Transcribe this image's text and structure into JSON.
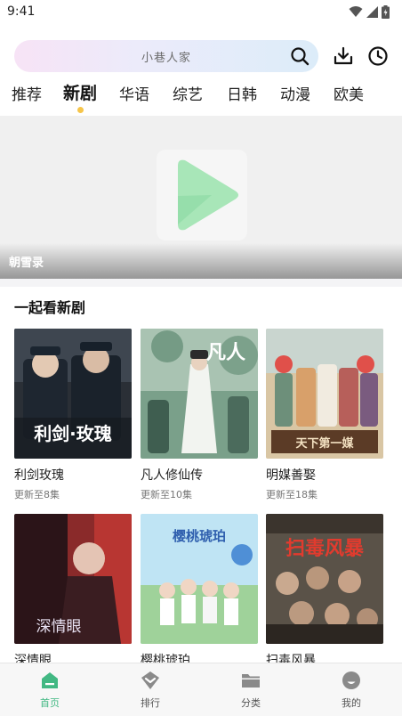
{
  "status_bar": {
    "time": "9:41"
  },
  "search": {
    "placeholder": "小巷人家"
  },
  "tabs": [
    "推荐",
    "新剧",
    "华语",
    "综艺",
    "日韩",
    "动漫",
    "欧美"
  ],
  "active_tab": "新剧",
  "banner": {
    "title": "朝雪录"
  },
  "section": {
    "title": "一起看新剧",
    "items": [
      {
        "title": "利剑玫瑰",
        "subtitle": "更新至8集",
        "poster_text": "利剑·玫瑰"
      },
      {
        "title": "凡人修仙传",
        "subtitle": "更新至10集",
        "poster_text": "凡人"
      },
      {
        "title": "明媒善娶",
        "subtitle": "更新至18集",
        "poster_text": "天下第一媒"
      },
      {
        "title": "深情眼",
        "subtitle": "",
        "poster_text": "深情眼"
      },
      {
        "title": "樱桃琥珀",
        "subtitle": "",
        "poster_text": "樱桃琥珀"
      },
      {
        "title": "扫毒风暴",
        "subtitle": "",
        "poster_text": "扫毒风暴"
      }
    ]
  },
  "bottom_nav": [
    {
      "label": "首页",
      "icon": "home-icon",
      "active": true
    },
    {
      "label": "排行",
      "icon": "ranking-icon",
      "active": false
    },
    {
      "label": "分类",
      "icon": "folder-icon",
      "active": false
    },
    {
      "label": "我的",
      "icon": "profile-icon",
      "active": false
    }
  ],
  "colors": {
    "accent": "#42b883",
    "tab_dot": "#f6c54a",
    "logo_green": "#a8e6b8"
  }
}
